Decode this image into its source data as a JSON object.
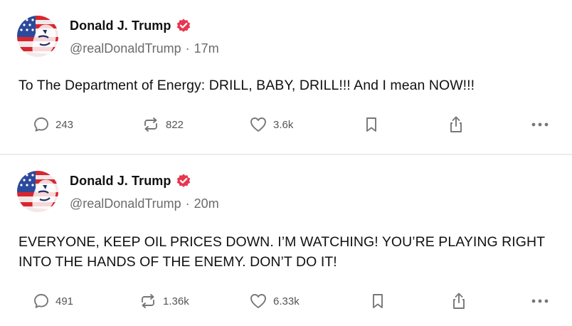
{
  "posts": [
    {
      "author": {
        "display_name": "Donald J. Trump",
        "handle": "@realDonaldTrump",
        "verified": true
      },
      "separator": "·",
      "time": "17m",
      "text": "To The Department of Energy: DRILL, BABY, DRILL!!!  And I mean NOW!!!",
      "actions": {
        "replies": "243",
        "reposts": "822",
        "likes": "3.6k"
      }
    },
    {
      "author": {
        "display_name": "Donald J. Trump",
        "handle": "@realDonaldTrump",
        "verified": true
      },
      "separator": "·",
      "time": "20m",
      "text": "EVERYONE, KEEP OIL PRICES DOWN. I’M WATCHING! YOU’RE PLAYING RIGHT INTO THE HANDS OF THE ENEMY. DON’T DO IT!",
      "actions": {
        "replies": "491",
        "reposts": "1.36k",
        "likes": "6.33k"
      }
    }
  ],
  "colors": {
    "verified_badge": "#e8364f",
    "text_primary": "#111111",
    "text_secondary": "#6b6b6b",
    "icon": "#777777",
    "divider": "#ececec"
  },
  "icons": {
    "reply": "speech-bubble-icon",
    "repost": "repost-arrows-icon",
    "like": "heart-icon",
    "bookmark": "bookmark-icon",
    "share": "share-upload-icon",
    "more": "more-dots-icon",
    "verified": "verified-badge-icon"
  }
}
